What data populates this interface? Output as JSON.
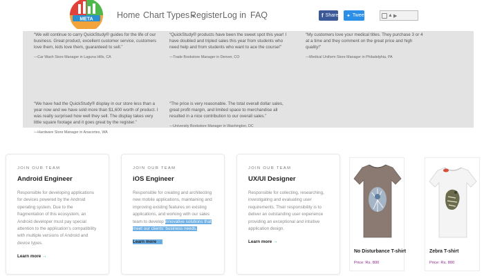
{
  "nav": {
    "logo_text": "META",
    "home": "Home",
    "chart_types": "Chart Types",
    "register": "Register",
    "login": "Log in",
    "faq": "FAQ",
    "share_fb": "Share",
    "share_tw": "Tweet"
  },
  "testimonials": [
    {
      "text": "“We will continue to carry QuickStudy® guides for the life of our business. Great product, excellent customer service, customers love them, kids love them, guaranteed to sell.”",
      "attr": "—Car Wash Store Manager in Laguna Hills, CA"
    },
    {
      "text": "“QuickStudy® products have been the sweet spot this year! I have doubled and tripled sales this year from students who need help and from students who want to ace the course!”",
      "attr": "—Trade Bookstore Manager in Denver, CO"
    },
    {
      "text": "“My customers love your medical titles. They purchase 3 or 4 at a time and they comment on the great price and high quality!”",
      "attr": "—Medical Uniform Store Manager in Philadelphia, PA"
    },
    {
      "text": "“We have had the QuickStudy® display in our store less than a year now and we have sold more than $1,600 worth of product. I was really surprised how well they sell. The display takes very little square footage and it goes great by the register.”",
      "attr": "—Hardware Store Manager in Anacortes, WA"
    },
    {
      "text": "“The price is very reasonable. The total overall dollar sales, great profit margin, and limited space to merchandise all resulted in a nice contribution to our overall sales.”",
      "attr": "—University Bookstore Manager in Washington, DC"
    }
  ],
  "jobs": [
    {
      "tag": "JOIN OUR TEAM",
      "title": "Android Engineer",
      "desc": "Responsible for developing applications for devices powered by the Android operating system. Due to the fragmentation of this ecosystem, an Android developer must pay special attention to the application's compatibility with multiple versions of Android and device types.",
      "more": "Learn more"
    },
    {
      "tag": "JOIN OUR TEAM",
      "title": "iOS Engineer",
      "desc_plain": "Responsible for creating and architecting new mobile applications, maintaining and improving existing features on existing applications, and working with our sales team to develop ",
      "desc_selected": "innovative solutions that meet our clients' business needs.",
      "more": "Learn more"
    },
    {
      "tag": "JOIN OUR TEAM",
      "title": "UX/UI Designer",
      "desc": "Responsible for collecting, researching, investigating and evaluating user requirements. Their responsibility is to deliver an outstanding user experience providing an exceptional and intuitive application design.",
      "more": "Learn more"
    }
  ],
  "products": [
    {
      "name": "No Disturbance T-shirt",
      "price": "Price: Rs. 800",
      "color": "#8a7a72"
    },
    {
      "name": "Zebra T-shirt",
      "price": "Price: Rs. 800",
      "color": "#f4f4f4"
    }
  ],
  "icons": {
    "logo": "meta-logo",
    "dropdown": "caret-down-icon",
    "facebook": "facebook-icon",
    "twitter": "twitter-icon",
    "translate": "translate-icon",
    "arrow": "arrow-right-icon"
  },
  "colors": {
    "accent_teal": "#18a78a",
    "price_purple": "#8e2a8e",
    "selection": "#6aaee5",
    "facebook": "#3b5998",
    "twitter": "#2b8fe8"
  }
}
